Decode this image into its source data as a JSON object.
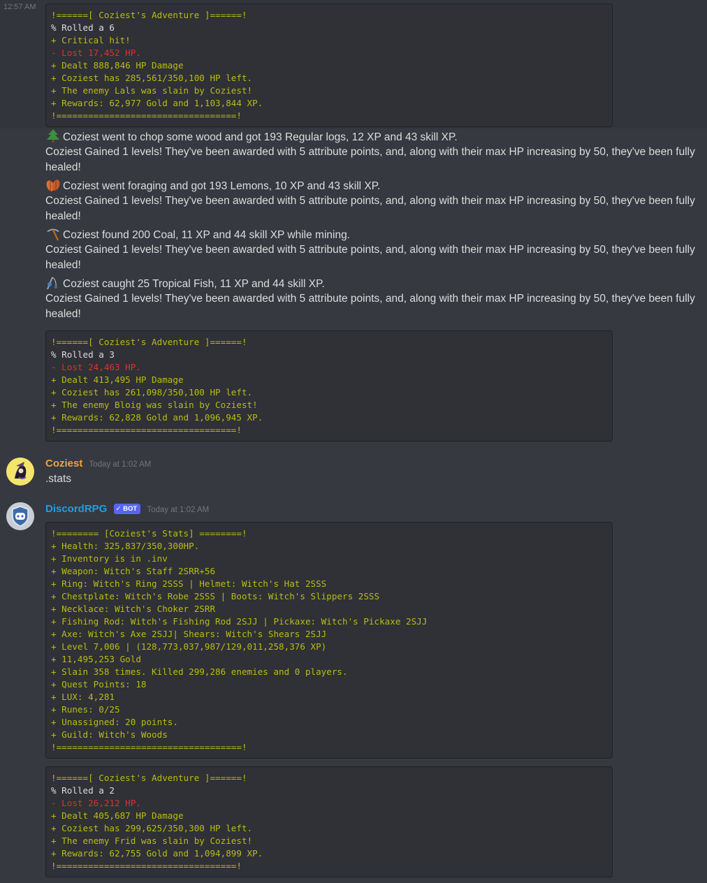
{
  "gutter_timestamp": "12:57 AM",
  "block1": [
    {
      "t": "bang",
      "s": "!======[ Coziest's Adventure ]======!"
    },
    {
      "t": "norm",
      "s": "% Rolled a 6"
    },
    {
      "t": "plus",
      "s": "+ Critical hit!"
    },
    {
      "t": "minus",
      "s": "- Lost 17,452 HP."
    },
    {
      "t": "plus",
      "s": "+ Dealt 888,846 HP Damage"
    },
    {
      "t": "plus",
      "s": "+ Coziest has 285,561/350,100 HP left."
    },
    {
      "t": "plus",
      "s": "+ The enemy Lals was slain by Coziest!"
    },
    {
      "t": "plus",
      "s": "+ Rewards: 62,977 Gold and 1,103,844 XP."
    },
    {
      "t": "bang",
      "s": "!==================================!"
    }
  ],
  "skill_messages": {
    "chop": "Coziest went to chop some wood and got 193 Regular logs, 12 XP and 43 skill XP.",
    "forage": "Coziest went foraging and got 193 Lemons, 10 XP and 43 skill XP.",
    "mine": "Coziest found 200 Coal, 11 XP and 44 skill XP while mining.",
    "fish": "Coziest caught 25 Tropical Fish, 11 XP and 44 skill XP.",
    "level_line1": "Coziest Gained 1 levels! They've been awarded with 5 attribute points, and, along with their max HP increasing by 50, they've been fully",
    "level_line2": "healed!"
  },
  "block2": [
    {
      "t": "bang",
      "s": "!======[ Coziest's Adventure ]======!"
    },
    {
      "t": "norm",
      "s": "% Rolled a 3"
    },
    {
      "t": "minus",
      "s": "- Lost 24,463 HP."
    },
    {
      "t": "plus",
      "s": "+ Dealt 413,495 HP Damage"
    },
    {
      "t": "plus",
      "s": "+ Coziest has 261,098/350,100 HP left."
    },
    {
      "t": "plus",
      "s": "+ The enemy Bloig was slain by Coziest!"
    },
    {
      "t": "plus",
      "s": "+ Rewards: 62,828 Gold and 1,096,945 XP."
    },
    {
      "t": "bang",
      "s": "!==================================!"
    }
  ],
  "msg_user": {
    "username": "Coziest",
    "timestamp": "Today at 1:02 AM",
    "content": ".stats",
    "name_color": "#f5a03c"
  },
  "msg_bot": {
    "username": "DiscordRPG",
    "bot_tag": "✓ BOT",
    "timestamp": "Today at 1:02 AM",
    "name_color": "#1e9ee6"
  },
  "block3": [
    {
      "t": "bang",
      "s": "!======== [Coziest's Stats] ========!"
    },
    {
      "t": "plus",
      "s": "+ Health: 325,837/350,300HP."
    },
    {
      "t": "plus",
      "s": "+ Inventory is in .inv"
    },
    {
      "t": "plus",
      "s": "+ Weapon: Witch's Staff 2SRR+56"
    },
    {
      "t": "plus",
      "s": "+ Ring: Witch's Ring 2SSS | Helmet: Witch's Hat 2SSS"
    },
    {
      "t": "plus",
      "s": "+ Chestplate: Witch's Robe 2SSS | Boots: Witch's Slippers 2SSS"
    },
    {
      "t": "plus",
      "s": "+ Necklace: Witch's Choker 2SRR"
    },
    {
      "t": "plus",
      "s": "+ Fishing Rod: Witch's Fishing Rod 2SJJ | Pickaxe: Witch's Pickaxe 2SJJ"
    },
    {
      "t": "plus",
      "s": "+ Axe: Witch's Axe 2SJJ| Shears: Witch's Shears 2SJJ"
    },
    {
      "t": "plus",
      "s": "+ Level 7,006 | (128,773,037,987/129,011,258,376 XP)"
    },
    {
      "t": "plus",
      "s": "+ 11,495,253 Gold"
    },
    {
      "t": "plus",
      "s": "+ Slain 358 times. Killed 299,286 enemies and 0 players."
    },
    {
      "t": "plus",
      "s": "+ Quest Points: 18"
    },
    {
      "t": "plus",
      "s": "+ LUX: 4,281"
    },
    {
      "t": "plus",
      "s": "+ Runes: 0/25"
    },
    {
      "t": "plus",
      "s": "+ Unassigned: 20 points."
    },
    {
      "t": "plus",
      "s": "+ Guild: Witch's Woods"
    },
    {
      "t": "bang",
      "s": "!===================================!"
    }
  ],
  "block4": [
    {
      "t": "bang",
      "s": "!======[ Coziest's Adventure ]======!"
    },
    {
      "t": "norm",
      "s": "% Rolled a 2"
    },
    {
      "t": "minus",
      "s": "- Lost 26,212 HP."
    },
    {
      "t": "plus",
      "s": "+ Dealt 405,687 HP Damage"
    },
    {
      "t": "plus",
      "s": "+ Coziest has 299,625/350,300 HP left."
    },
    {
      "t": "plus",
      "s": "+ The enemy Frid was slain by Coziest!"
    },
    {
      "t": "plus",
      "s": "+ Rewards: 62,755 Gold and 1,094,899 XP."
    },
    {
      "t": "bang",
      "s": "!==================================!"
    }
  ],
  "colors": {
    "background": "#36393f",
    "codeblock_bg": "#2f3136",
    "diff_plus": "#b9bc13",
    "diff_minus": "#dc322f",
    "bot_tag": "#5865f2"
  }
}
